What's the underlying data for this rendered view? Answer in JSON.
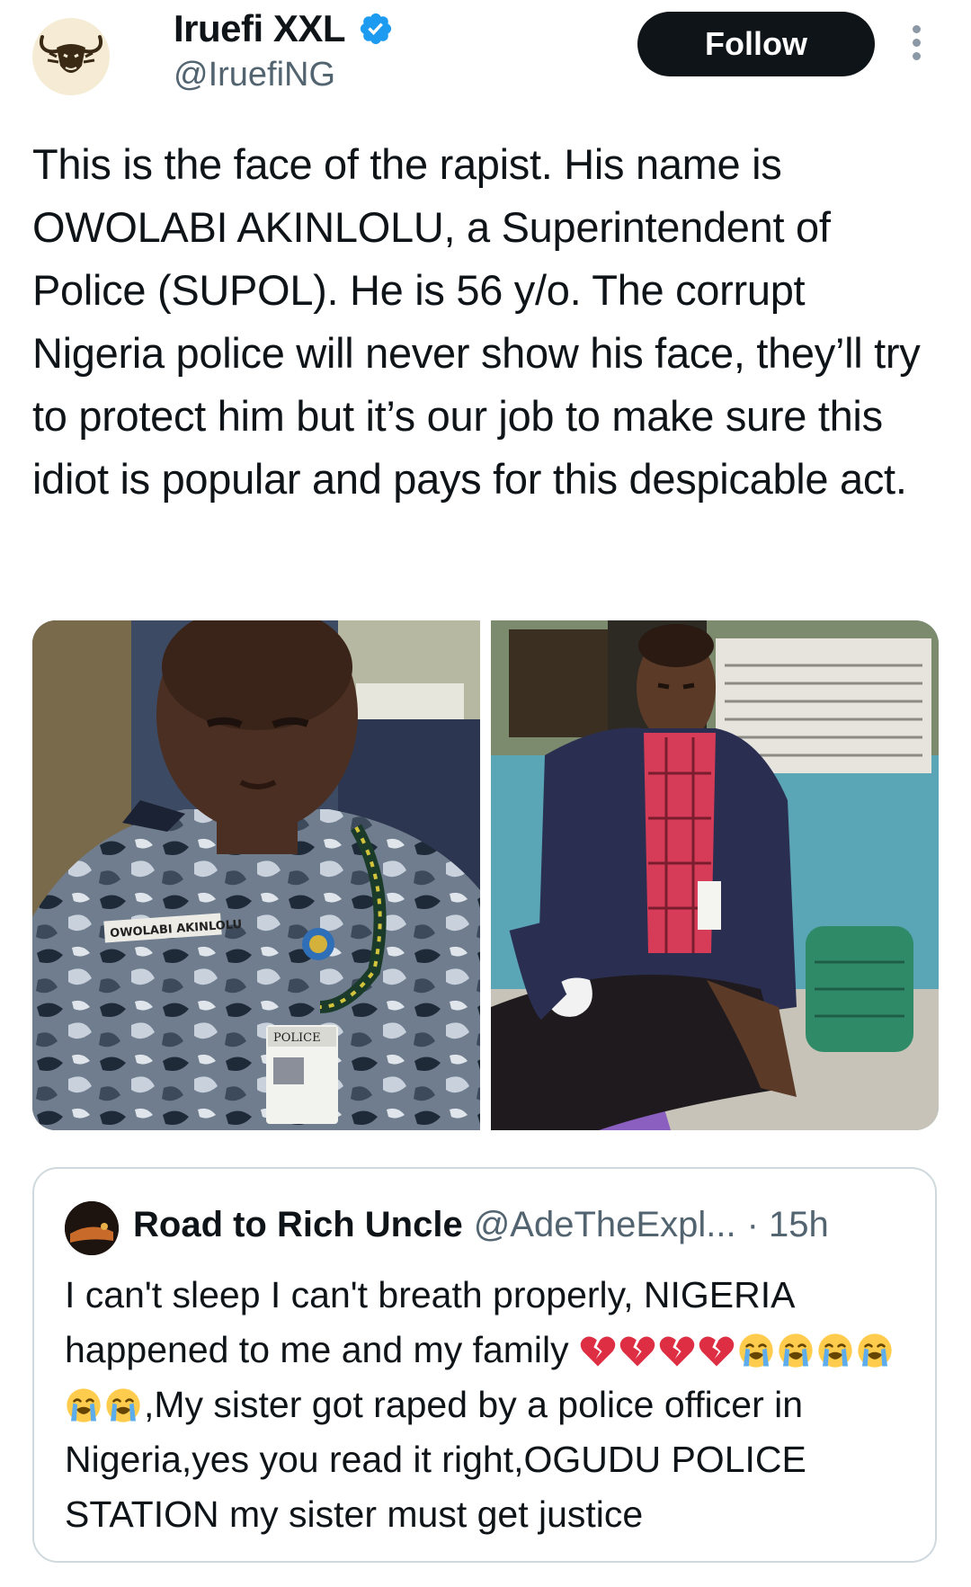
{
  "author": {
    "display_name": "Iruefi XXL",
    "handle": "@IruefiNG",
    "verified": true,
    "avatar_icon": "bull-skull-icon"
  },
  "follow_label": "Follow",
  "more_icon": "more-vertical-icon",
  "tweet": {
    "text": "This is the face of the rapist. His name is OWOLABI AKINLOLU, a Superintendent of Police (SUPOL). He is 56 y/o. The corrupt Nigeria police will never show his face, they’ll try to protect him but it’s our job to make sure this idiot is popular and pays for this despicable act."
  },
  "media": {
    "photo_left": {
      "name_tag": "OWOLABI AKINLOLU",
      "badge_label": "POLICE"
    },
    "photo_right": {}
  },
  "quote": {
    "display_name": "Road to Rich Uncle",
    "handle": "@AdeTheExpl...",
    "time": "· 15h",
    "text_part1": "I can't sleep I can't breath properly, NIGERIA happened to me and my family ",
    "text_part2": ",My sister got raped by a police officer in Nigeria,yes you read it right,OGUDU POLICE STATION my sister must get justice",
    "emoji_group1": [
      "broken-heart",
      "broken-heart",
      "broken-heart",
      "broken-heart",
      "loudly-crying-face"
    ],
    "emoji_group2": [
      "loudly-crying-face",
      "loudly-crying-face",
      "loudly-crying-face",
      "loudly-crying-face",
      "loudly-crying-face"
    ]
  },
  "colors": {
    "text": "#0f1419",
    "secondary": "#536471",
    "verified": "#1d9bf0",
    "follow_bg": "#0f1419",
    "border": "#cfd9de"
  }
}
